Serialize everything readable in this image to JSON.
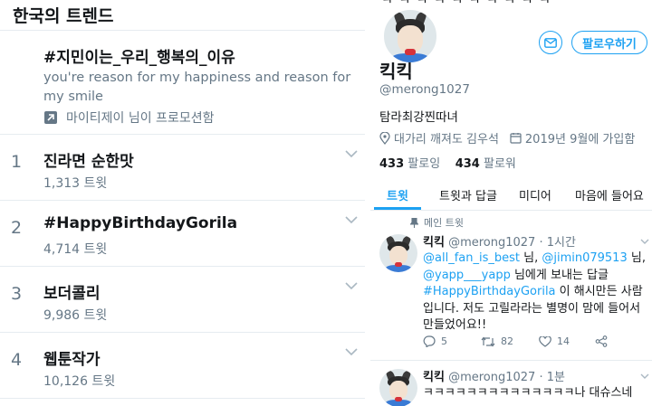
{
  "trends": {
    "header": "한국의 트렌드",
    "promoted": {
      "title": "#지민이는_우리_행복의_이유",
      "description": "you're reason for my happiness and reason for my smile",
      "by": "마이티제이 님이 프로모션함"
    },
    "items": [
      {
        "rank": "1",
        "name": "진라면 순한맛",
        "count": "1,313 트윗"
      },
      {
        "rank": "2",
        "name": "#HappyBirthdayGorila",
        "count": "4,714 트윗"
      },
      {
        "rank": "3",
        "name": "보더콜리",
        "count": "9,986 트윗"
      },
      {
        "rank": "4",
        "name": "웹툰작가",
        "count": "10,126 트윗"
      }
    ]
  },
  "profile": {
    "top_cut_text": "ㅋ ㅋ ㅋ ㅋ ㅋ ㅋ ㅋ ㅋ ㅋ ㅋ",
    "name": "킥킥",
    "handle": "@merong1027",
    "bio": "탐라최강찐따녀",
    "location": "대가리 깨져도 김우석",
    "joined": "2019년 9월에 가입함",
    "following_count": "433",
    "following_label": "팔로잉",
    "followers_count": "434",
    "followers_label": "팔로워",
    "follow_button": "팔로우하기",
    "tabs": [
      "트윗",
      "트윗과 답글",
      "미디어",
      "마음에 들어요"
    ],
    "pinned_label": "메인 트윗"
  },
  "tweets": [
    {
      "name": "킥킥",
      "handle": "@merong1027",
      "time": "· 1시간",
      "mention1": "@all_fan_is_best",
      "mention2": "@jimin079513",
      "mention3": "@yapp___yapp",
      "nim": "님,",
      "nim2": "님,",
      "to_reply": "님에게 보내는 답글",
      "hashtag": "#HappyBirthdayGorila",
      "text": "이 해시만든 사람입니다. 저도 고릴라라는 별명이 맘에 들어서 만들었어요!!",
      "replies": "5",
      "retweets": "82",
      "likes": "14"
    },
    {
      "name": "킥킥",
      "handle": "@merong1027",
      "time": "· 1분",
      "text": "ㅋㅋㅋㅋㅋㅋㅋㅋㅋㅋㅋㅋㅋㅋ나 대슈스네"
    }
  ],
  "colors": {
    "accent": "#1da1f2",
    "muted": "#657786",
    "text": "#14171a",
    "divider": "#e6ecf0"
  }
}
